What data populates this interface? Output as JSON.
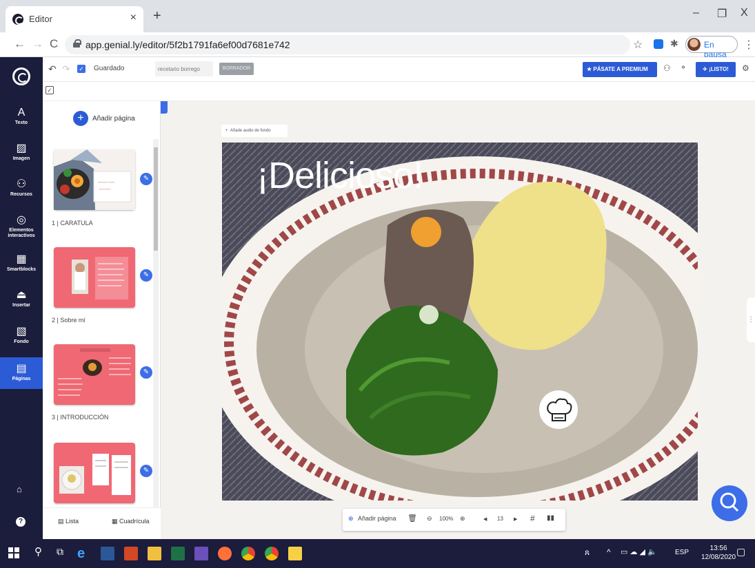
{
  "browser": {
    "tab_title": "Editor",
    "tab_close": "×",
    "new_tab": "+",
    "url": "app.genial.ly/editor/5f2b1791fa6ef00d7681e742",
    "profile_status": "En pausa",
    "window_controls": [
      "–",
      "❐",
      "X"
    ]
  },
  "nav": {
    "items": [
      {
        "label": "Texto",
        "icon": "A"
      },
      {
        "label": "Imagen",
        "icon": "▨"
      },
      {
        "label": "Recursos",
        "icon": "⚇"
      },
      {
        "label": "Elementos interactivos",
        "icon": "◎"
      },
      {
        "label": "Smartblocks",
        "icon": "▦"
      },
      {
        "label": "Insertar",
        "icon": "⏏"
      },
      {
        "label": "Fondo",
        "icon": "▧"
      },
      {
        "label": "Páginas",
        "icon": "▤"
      }
    ]
  },
  "toolbar": {
    "saved_label": "Guardado",
    "project_name": "recetario borrego",
    "draft_label": "BORRADOR",
    "premium_label": "PÁSATE A PREMIUM",
    "ready_label": "¡LISTO!"
  },
  "pages_panel": {
    "add_page_label": "Añadir página",
    "pages": [
      {
        "label": "1 | CARATULA"
      },
      {
        "label": "2 | Sobre mí"
      },
      {
        "label": "3 | INTRODUCCIÓN"
      },
      {
        "label": ""
      }
    ],
    "view_list_label": "Lista",
    "view_grid_label": "Cuadrícula"
  },
  "canvas": {
    "audio_label": "Añade audio de fondo",
    "slide_heading": "¡Delicioso!",
    "bottom_bar": {
      "add_page_label": "Añadir página",
      "zoom": "100%",
      "page_number": "13"
    }
  },
  "taskbar": {
    "language": "ESP",
    "time": "13:56",
    "date": "12/08/2020"
  },
  "colors": {
    "accent": "#2c5bd6",
    "nav_bg": "#1a1d3b",
    "thumb_pink": "#f06873"
  }
}
